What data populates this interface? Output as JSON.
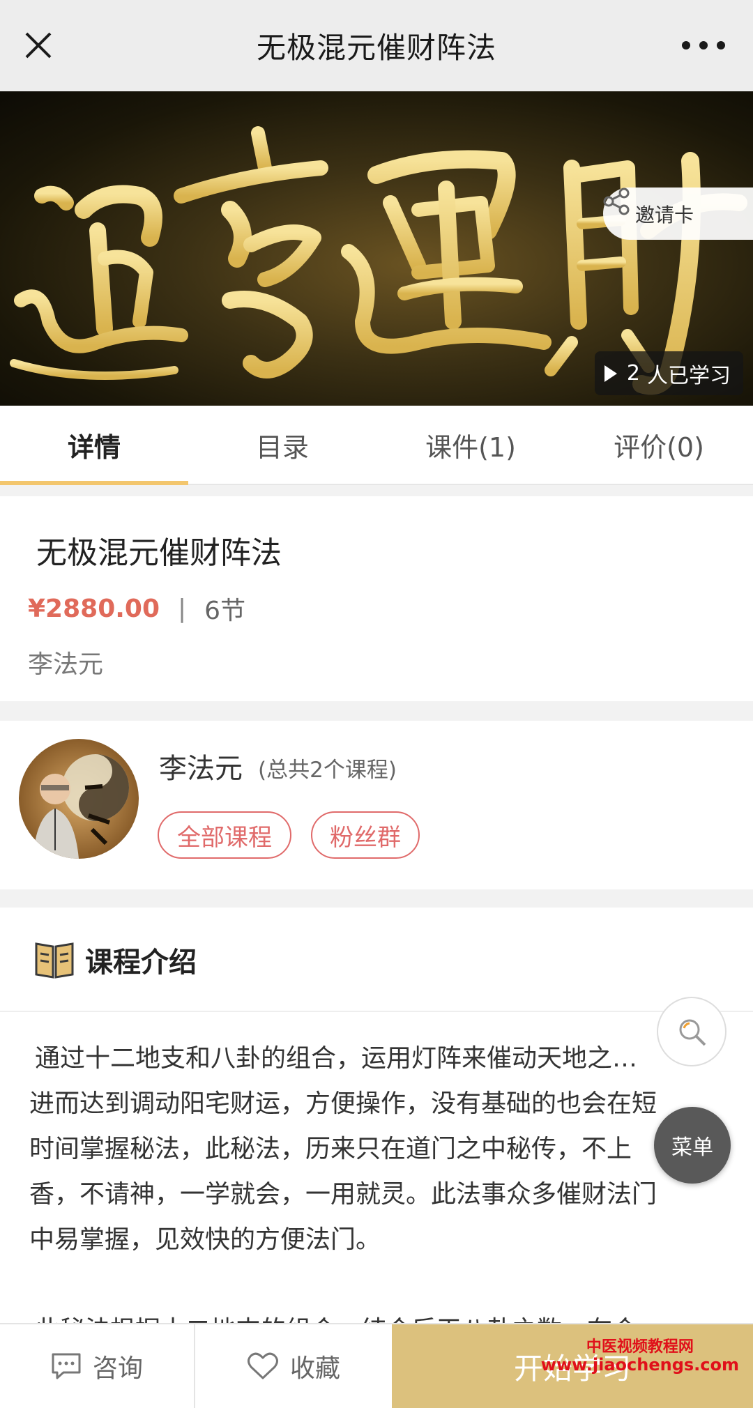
{
  "header": {
    "title": "无极混元催财阵法",
    "close_icon": "close-icon",
    "more_icon": "more-dots-icon"
  },
  "banner": {
    "calligraphy_text": "通亨運財",
    "invite_label": "邀请卡",
    "learners_count": "2",
    "learners_suffix": "人已学习"
  },
  "tabs": [
    {
      "label": "详情",
      "active": true
    },
    {
      "label": "目录"
    },
    {
      "label": "课件(1)"
    },
    {
      "label": "评价(0)"
    }
  ],
  "course": {
    "title": "无极混元催财阵法",
    "price": "¥2880.00",
    "separator": "|",
    "lessons": "6节",
    "teacher": "李法元"
  },
  "teacher_card": {
    "name": "李法元",
    "course_count": "(总共2个课程)",
    "all_courses_label": "全部课程",
    "fans_group_label": "粉丝群"
  },
  "intro": {
    "heading": "课程介绍",
    "lines": [
      "通过十二地支和八卦的组合，运用灯阵来催动天地之…",
      "进而达到调动阳宅财运，方便操作，没有基础的也会在短",
      "时间掌握秘法，此秘法，历来只在道门之中秘传，不上",
      "香，不请神，一学就会，一用就灵。此法事众多催财法门",
      "中易掌握，见效快的方便法门。"
    ],
    "partial_line": "此秘法根据十二地支的组合，结合后天八卦之数，在合"
  },
  "fab": {
    "menu_label": "菜单"
  },
  "bottom": {
    "consult_label": "咨询",
    "favorite_label": "收藏",
    "start_label": "开始学习",
    "watermark_line1": "中医视频教程网",
    "watermark_line2": "www.jiaochengs.com"
  },
  "colors": {
    "accent": "#dcc17d",
    "price": "#e06a5a",
    "tab_underline": "#f3c66d",
    "pill": "#e06a6a"
  }
}
